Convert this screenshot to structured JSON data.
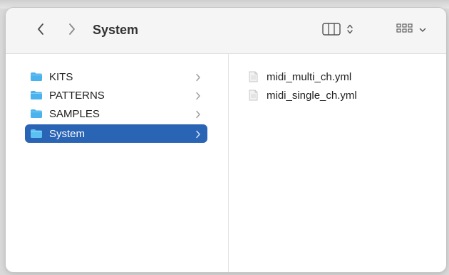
{
  "toolbar": {
    "title": "System",
    "back_icon": "chevron-left-icon",
    "forward_icon": "chevron-right-icon",
    "view_mode_icon": "column-view-icon",
    "group_icon": "grid-view-icon"
  },
  "sidebar": {
    "folders": [
      {
        "label": "KITS",
        "icon": "folder-icon",
        "selected": false
      },
      {
        "label": "PATTERNS",
        "icon": "folder-icon",
        "selected": false
      },
      {
        "label": "SAMPLES",
        "icon": "folder-icon",
        "selected": false
      },
      {
        "label": "System",
        "icon": "folder-icon",
        "selected": true
      }
    ]
  },
  "content": {
    "files": [
      {
        "label": "midi_multi_ch.yml",
        "icon": "document-icon"
      },
      {
        "label": "midi_single_ch.yml",
        "icon": "document-icon"
      }
    ]
  },
  "colors": {
    "selection": "#2a64b4",
    "folder": "#4ab2ec",
    "toolbar_bg": "#f5f5f5"
  }
}
